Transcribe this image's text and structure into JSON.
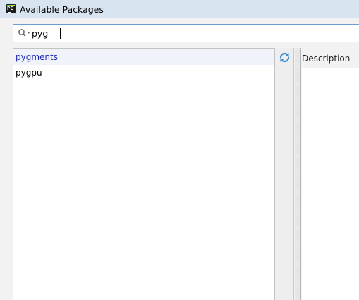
{
  "window": {
    "title": "Available Packages",
    "app_icon": "pycharm-icon"
  },
  "search": {
    "value": "pyg",
    "icon": "search-icon"
  },
  "packages": {
    "items": [
      {
        "label": "pygments",
        "selected": true
      },
      {
        "label": "pygpu",
        "selected": false
      }
    ]
  },
  "toolbar": {
    "refresh_icon": "refresh-icon"
  },
  "description": {
    "label": "Description"
  },
  "colors": {
    "titlebar": "#d9e4f1",
    "selected_text": "#1a28b4",
    "selected_row": "#f0f4fa",
    "search_border": "#6d9ecf",
    "refresh_icon": "#3b8fd6"
  }
}
